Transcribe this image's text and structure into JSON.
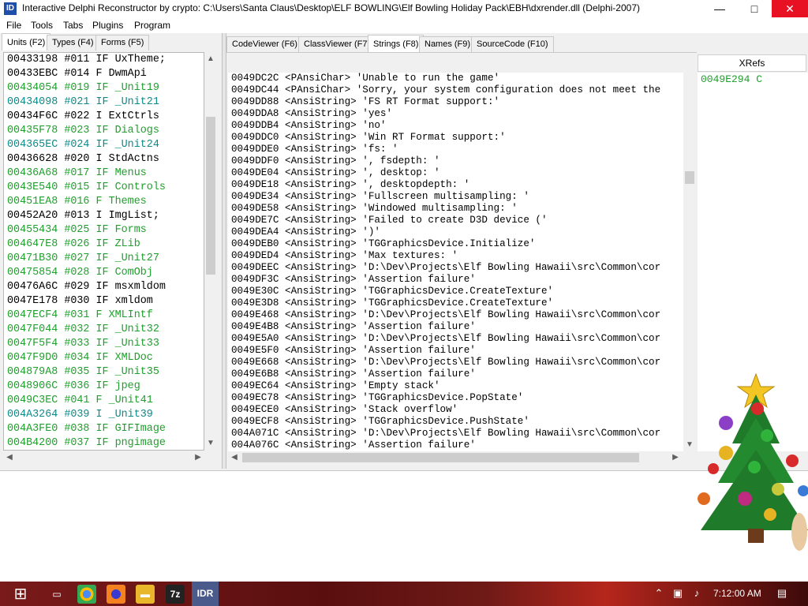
{
  "window": {
    "title": "Interactive Delphi Reconstructor by crypto: C:\\Users\\Santa Claus\\Desktop\\ELF BOWLING\\Elf Bowling Holiday Pack\\EBH\\dxrender.dll (Delphi-2007)",
    "minimize_glyph": "—",
    "maximize_glyph": "□",
    "close_glyph": "✕"
  },
  "menu": [
    "File",
    "Tools",
    "Tabs",
    "Plugins",
    "Program"
  ],
  "left_tabs": [
    "Units (F2)",
    "Types (F4)",
    "Forms (F5)"
  ],
  "right_tabs": [
    "CodeViewer (F6)",
    "ClassViewer (F7)",
    "Strings (F8)",
    "Names (F9)",
    "SourceCode (F10)"
  ],
  "units": [
    {
      "text": "00433198 #011 IF UxTheme;",
      "color": "pink"
    },
    {
      "text": "00433EBC #014  F DwmApi",
      "color": "pink"
    },
    {
      "text": "00434054 #019 IF _Unit19",
      "color": "green"
    },
    {
      "text": "00434098 #021 IF _Unit21",
      "color": "teal"
    },
    {
      "text": "00434F6C #022 I  ExtCtrls",
      "color": "pink"
    },
    {
      "text": "00435F78 #023 IF Dialogs",
      "color": "green"
    },
    {
      "text": "004365EC #024 IF _Unit24",
      "color": "teal"
    },
    {
      "text": "00436628 #020 I  StdActns",
      "color": "pink"
    },
    {
      "text": "00436A68 #017 IF Menus",
      "color": "green"
    },
    {
      "text": "0043E540 #015 IF Controls",
      "color": "green"
    },
    {
      "text": "00451EA8 #016  F Themes",
      "color": "green"
    },
    {
      "text": "00452A20 #013 I  ImgList;",
      "color": "pink"
    },
    {
      "text": "00455434 #025 IF Forms",
      "color": "green"
    },
    {
      "text": "004647E8 #026 IF ZLib",
      "color": "green"
    },
    {
      "text": "00471B30 #027 IF _Unit27",
      "color": "green"
    },
    {
      "text": "00475854 #028 IF ComObj",
      "color": "green"
    },
    {
      "text": "00476A6C #029 IF msxmldom",
      "color": "pink"
    },
    {
      "text": "0047E178 #030 IF xmldom",
      "color": "pink"
    },
    {
      "text": "0047ECF4 #031  F XMLIntf",
      "color": "green"
    },
    {
      "text": "0047F044 #032 IF _Unit32",
      "color": "green"
    },
    {
      "text": "0047F5F4 #033 IF _Unit33",
      "color": "green"
    },
    {
      "text": "0047F9D0 #034 IF XMLDoc",
      "color": "green"
    },
    {
      "text": "004879A8 #035 IF _Unit35",
      "color": "green"
    },
    {
      "text": "0048906C #036 IF jpeg",
      "color": "green"
    },
    {
      "text": "0049C3EC #041  F _Unit41",
      "color": "green"
    },
    {
      "text": "004A3264 #039 I  _Unit39",
      "color": "teal"
    },
    {
      "text": "004A3FE0 #038 IF GIFImage",
      "color": "green"
    },
    {
      "text": "004B4200 #037 IF pngimage",
      "color": "green"
    }
  ],
  "strings": [
    "0049DC2C <PAnsiChar> 'Unable to run the game'",
    "0049DC44 <PAnsiChar> 'Sorry, your system configuration does not meet the",
    "0049DD88 <AnsiString> 'FS RT Format support:'",
    "0049DDA8 <AnsiString> 'yes'",
    "0049DDB4 <AnsiString> 'no'",
    "0049DDC0 <AnsiString> 'Win RT Format support:'",
    "0049DDE0 <AnsiString> 'fs: '",
    "0049DDF0 <AnsiString> ', fsdepth: '",
    "0049DE04 <AnsiString> ', desktop: '",
    "0049DE18 <AnsiString> ', desktopdepth: '",
    "0049DE34 <AnsiString> 'Fullscreen multisampling: '",
    "0049DE58 <AnsiString> 'Windowed multisampling: '",
    "0049DE7C <AnsiString> 'Failed to create D3D device ('",
    "0049DEA4 <AnsiString> ')'",
    "0049DEB0 <AnsiString> 'TGGraphicsDevice.Initialize'",
    "0049DED4 <AnsiString> 'Max textures: '",
    "0049DEEC <AnsiString> 'D:\\Dev\\Projects\\Elf Bowling Hawaii\\src\\Common\\cor",
    "0049DF3C <AnsiString> 'Assertion failure'",
    "0049E30C <AnsiString> 'TGGraphicsDevice.CreateTexture'",
    "0049E3D8 <AnsiString> 'TGGraphicsDevice.CreateTexture'",
    "0049E468 <AnsiString> 'D:\\Dev\\Projects\\Elf Bowling Hawaii\\src\\Common\\cor",
    "0049E4B8 <AnsiString> 'Assertion failure'",
    "0049E5A0 <AnsiString> 'D:\\Dev\\Projects\\Elf Bowling Hawaii\\src\\Common\\cor",
    "0049E5F0 <AnsiString> 'Assertion failure'",
    "0049E668 <AnsiString> 'D:\\Dev\\Projects\\Elf Bowling Hawaii\\src\\Common\\cor",
    "0049E6B8 <AnsiString> 'Assertion failure'",
    "0049EC64 <AnsiString> 'Empty stack'",
    "0049EC78 <AnsiString> 'TGGraphicsDevice.PopState'",
    "0049ECE0 <AnsiString> 'Stack overflow'",
    "0049ECF8 <AnsiString> 'TGGraphicsDevice.PushState'",
    "004A071C <AnsiString> 'D:\\Dev\\Projects\\Elf Bowling Hawaii\\src\\Common\\cor",
    "004A076C <AnsiString> 'Assertion failure'"
  ],
  "xrefs": {
    "header": "XRefs",
    "items": [
      "0049E294 C"
    ]
  },
  "taskbar": {
    "time": "7:12:00 AM",
    "start_icon": "windows-logo",
    "apps": [
      "task-view",
      "chrome",
      "firefox",
      "file-explorer",
      "7zip",
      "delphi-reconstructor"
    ],
    "tray": [
      "show-hidden-icons",
      "network",
      "volume",
      "action-center"
    ],
    "seven_zip_label": "7z",
    "idr_label": "IDR"
  },
  "colors": {
    "green": "#1ea02c",
    "teal": "#0c8a8a",
    "close_red": "#e81123",
    "selected_tab_bg": "#ffffff"
  }
}
